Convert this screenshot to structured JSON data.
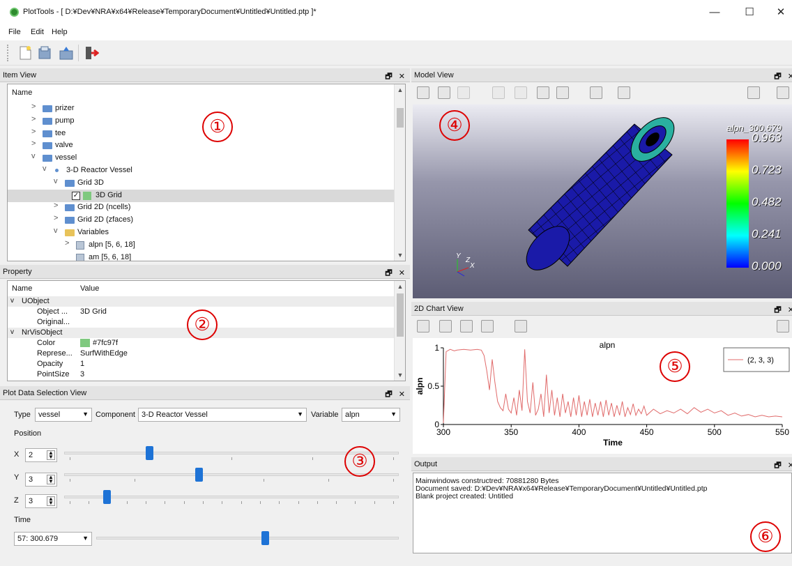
{
  "window": {
    "title": "PlotTools - [ D:¥Dev¥NRA¥x64¥Release¥TemporaryDocument¥Untitled¥Untitled.ptp ]*",
    "min_glyph": "—",
    "max_glyph": "☐",
    "close_glyph": "✕"
  },
  "menu": {
    "file": "File",
    "edit": "Edit",
    "help": "Help"
  },
  "dock_controls": "🗗 ✕",
  "item_view": {
    "title": "Item View",
    "header": "Name",
    "rows": [
      {
        "label": "prizer",
        "arrow": ">"
      },
      {
        "label": "pump",
        "arrow": ">"
      },
      {
        "label": "tee",
        "arrow": ">"
      },
      {
        "label": "valve",
        "arrow": ">"
      },
      {
        "label": "vessel",
        "arrow": "v"
      },
      {
        "label": "3-D Reactor Vessel",
        "arrow": "v"
      },
      {
        "label": "Grid 3D",
        "arrow": "v"
      },
      {
        "label": "3D Grid",
        "arrow": ""
      },
      {
        "label": "Grid 2D (ncells)",
        "arrow": ">"
      },
      {
        "label": "Grid 2D (zfaces)",
        "arrow": ">"
      },
      {
        "label": "Variables",
        "arrow": "v"
      },
      {
        "label": "alpn [5, 6, 18]",
        "arrow": ">"
      },
      {
        "label": "am [5, 6, 18]",
        "arrow": ""
      }
    ]
  },
  "property": {
    "title": "Property",
    "col_name": "Name",
    "col_value": "Value",
    "rows": [
      {
        "name": "UObject",
        "value": "",
        "group": true
      },
      {
        "name": "Object ...",
        "value": "3D Grid",
        "group": false
      },
      {
        "name": "Original...",
        "value": "",
        "group": false
      },
      {
        "name": "NrVisObject",
        "value": "",
        "group": true
      },
      {
        "name": "Color",
        "value": "#7fc97f",
        "group": false
      },
      {
        "name": "Represe...",
        "value": "SurfWithEdge",
        "group": false
      },
      {
        "name": "Opacity",
        "value": "1",
        "group": false
      },
      {
        "name": "PointSize",
        "value": "3",
        "group": false
      }
    ],
    "color_swatch": "#7fc97f"
  },
  "plot_selection": {
    "title": "Plot Data Selection View",
    "type_label": "Type",
    "type_value": "vessel",
    "component_label": "Component",
    "component_value": "3-D Reactor Vessel",
    "variable_label": "Variable",
    "variable_value": "alpn",
    "position_label": "Position",
    "x_label": "X",
    "x_value": "2",
    "y_label": "Y",
    "y_value": "3",
    "z_label": "Z",
    "z_value": "3",
    "time_label": "Time",
    "time_value": "57: 300.679"
  },
  "model_view": {
    "title": "Model View",
    "legend_title": "alpn_300.679",
    "legend_ticks": [
      "0.963",
      "0.723",
      "0.482",
      "0.241",
      "0.000"
    ],
    "axis_y": "Y",
    "axis_z": "Z",
    "axis_x": "X"
  },
  "chart_view": {
    "title": "2D Chart View"
  },
  "chart_data": {
    "type": "line",
    "title": "alpn",
    "xlabel": "Time",
    "ylabel": "alpn",
    "xlim": [
      300,
      550
    ],
    "ylim": [
      0,
      1
    ],
    "xticks": [
      "300",
      "350",
      "400",
      "450",
      "500",
      "550"
    ],
    "yticks": [
      "0",
      "0.5",
      "1"
    ],
    "legend": "top-right",
    "series": [
      {
        "name": "(2, 3, 3)",
        "color": "#e06a6a",
        "x": [
          300,
          302,
          305,
          308,
          310,
          315,
          320,
          325,
          328,
          330,
          332,
          334,
          336,
          338,
          340,
          342,
          344,
          346,
          348,
          350,
          352,
          354,
          356,
          358,
          360,
          362,
          364,
          366,
          368,
          370,
          372,
          374,
          376,
          378,
          380,
          382,
          384,
          386,
          388,
          390,
          392,
          394,
          396,
          398,
          400,
          402,
          404,
          406,
          408,
          410,
          412,
          414,
          416,
          418,
          420,
          422,
          424,
          426,
          428,
          430,
          432,
          434,
          436,
          438,
          440,
          442,
          444,
          446,
          448,
          450,
          455,
          460,
          465,
          470,
          475,
          480,
          485,
          490,
          495,
          500,
          505,
          510,
          515,
          520,
          525,
          530,
          535,
          540,
          545,
          550
        ],
        "y": [
          0.02,
          0.95,
          0.98,
          0.96,
          0.97,
          0.98,
          0.97,
          0.98,
          0.97,
          0.9,
          0.7,
          0.45,
          0.85,
          0.55,
          0.3,
          0.22,
          0.18,
          0.4,
          0.2,
          0.15,
          0.35,
          0.12,
          0.45,
          0.18,
          0.98,
          0.3,
          0.15,
          0.55,
          0.12,
          0.2,
          0.4,
          0.1,
          0.65,
          0.15,
          0.45,
          0.12,
          0.35,
          0.1,
          0.4,
          0.15,
          0.3,
          0.1,
          0.35,
          0.12,
          0.38,
          0.1,
          0.3,
          0.12,
          0.33,
          0.1,
          0.28,
          0.12,
          0.3,
          0.1,
          0.32,
          0.12,
          0.28,
          0.1,
          0.25,
          0.12,
          0.3,
          0.1,
          0.22,
          0.13,
          0.27,
          0.12,
          0.2,
          0.14,
          0.24,
          0.12,
          0.2,
          0.14,
          0.18,
          0.15,
          0.2,
          0.14,
          0.22,
          0.16,
          0.2,
          0.15,
          0.18,
          0.12,
          0.15,
          0.11,
          0.13,
          0.1,
          0.12,
          0.1,
          0.11,
          0.1
        ]
      }
    ]
  },
  "output": {
    "title": "Output",
    "lines": [
      "Mainwindows constructred: 70881280 Bytes",
      "Document saved: D:¥Dev¥NRA¥x64¥Release¥TemporaryDocument¥Untitled¥Untitled.ptp",
      "Blank project created: Untitled"
    ]
  },
  "annotations": [
    "①",
    "②",
    "③",
    "④",
    "⑤",
    "⑥"
  ]
}
